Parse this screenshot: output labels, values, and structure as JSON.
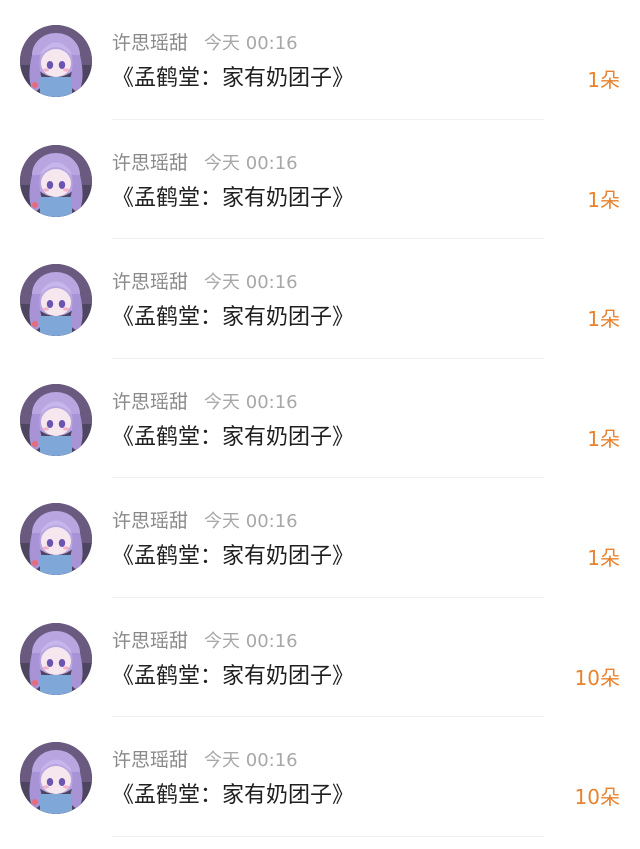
{
  "gifts": [
    {
      "name": "许思瑶甜",
      "time": "今天 00:16",
      "title": "《孟鹤堂：家有奶团子》",
      "amount": "1朵"
    },
    {
      "name": "许思瑶甜",
      "time": "今天 00:16",
      "title": "《孟鹤堂：家有奶团子》",
      "amount": "1朵"
    },
    {
      "name": "许思瑶甜",
      "time": "今天 00:16",
      "title": "《孟鹤堂：家有奶团子》",
      "amount": "1朵"
    },
    {
      "name": "许思瑶甜",
      "time": "今天 00:16",
      "title": "《孟鹤堂：家有奶团子》",
      "amount": "1朵"
    },
    {
      "name": "许思瑶甜",
      "time": "今天 00:16",
      "title": "《孟鹤堂：家有奶团子》",
      "amount": "1朵"
    },
    {
      "name": "许思瑶甜",
      "time": "今天 00:16",
      "title": "《孟鹤堂：家有奶团子》",
      "amount": "10朵"
    },
    {
      "name": "许思瑶甜",
      "time": "今天 00:16",
      "title": "《孟鹤堂：家有奶团子》",
      "amount": "10朵"
    }
  ],
  "colors": {
    "amount": "#e8822e",
    "name": "#8a8a8a",
    "time": "#a8a8a8",
    "title": "#1f1f1f"
  }
}
